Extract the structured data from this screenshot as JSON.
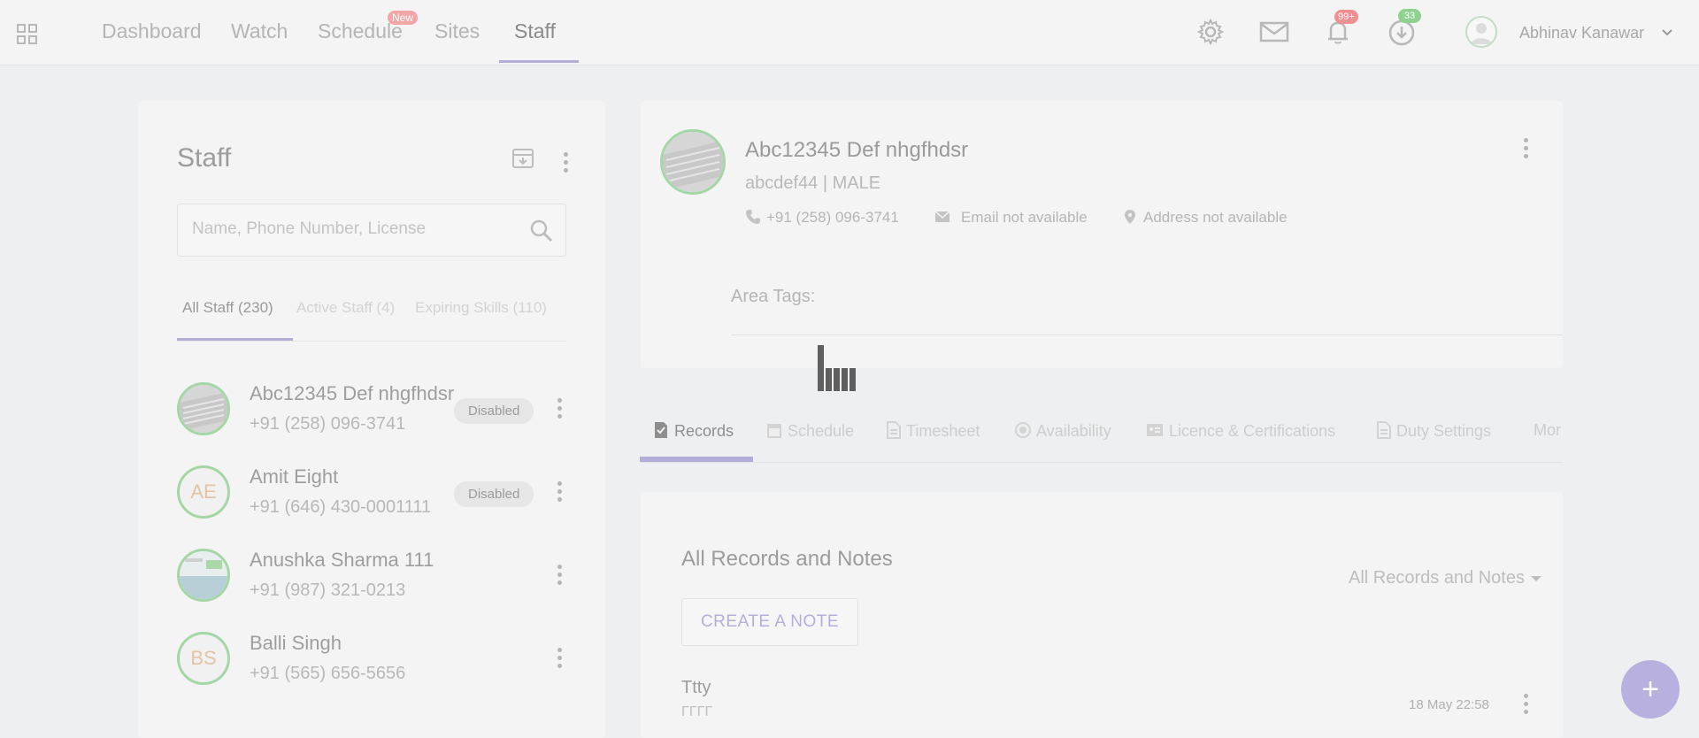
{
  "nav": {
    "items": [
      {
        "label": "Dashboard"
      },
      {
        "label": "Watch"
      },
      {
        "label": "Schedule",
        "badge": "New"
      },
      {
        "label": "Sites"
      },
      {
        "label": "Staff",
        "active": true
      }
    ],
    "notifications_count": "99+",
    "downloads_count": "33",
    "user_name": "Abhinav Kanawar",
    "icons": [
      "apps-grid-icon",
      "settings-gear-icon",
      "mail-icon",
      "bell-icon",
      "clock-download-icon",
      "chevron-down-icon"
    ]
  },
  "staff_panel": {
    "title": "Staff",
    "search_placeholder": "Name, Phone Number, License",
    "filters": [
      {
        "label": "All Staff (230)",
        "active": true
      },
      {
        "label": "Active Staff (4)"
      },
      {
        "label": "Expiring Skills (110)"
      }
    ],
    "staff": [
      {
        "name": "Abc12345 Def nhgfhdsr",
        "phone": "+91 (258) 096-3741",
        "status": "Disabled",
        "avatar": "photo"
      },
      {
        "name": "Amit Eight",
        "phone": "+91 (646) 430-0001111",
        "status": "Disabled",
        "initials": "AE"
      },
      {
        "name": "Anushka Sharma 111",
        "phone": "+91 (987) 321-0213",
        "status": "",
        "avatar": "photo"
      },
      {
        "name": "Balli Singh",
        "phone": "+91 (565) 656-5656",
        "status": "",
        "initials": "BS"
      }
    ]
  },
  "profile": {
    "name": "Abc12345 Def nhgfhdsr",
    "subtitle": "abcdef44 | MALE",
    "phone": "+91 (258) 096-3741",
    "email": "Email not available",
    "address": "Address not available",
    "area_tags_label": "Area Tags:"
  },
  "tabs": [
    {
      "label": "Records",
      "icon": "records-icon",
      "active": true
    },
    {
      "label": "Schedule",
      "icon": "calendar-icon"
    },
    {
      "label": "Timesheet",
      "icon": "document-icon"
    },
    {
      "label": "Availability",
      "icon": "availability-icon"
    },
    {
      "label": "Licence & Certifications",
      "icon": "id-card-icon"
    },
    {
      "label": "Duty Settings",
      "icon": "document-icon"
    },
    {
      "label": "Mor"
    }
  ],
  "records": {
    "title": "All Records and Notes",
    "filter_label": "All Records and Notes",
    "create_button": "CREATE A NOTE",
    "notes": [
      {
        "title": "Ttty",
        "body": "ΓΓΓΓ",
        "date": "18 May 22:58"
      }
    ]
  },
  "fab_label": "+",
  "colors": {
    "accent": "#b3acd6",
    "avatar_ring": "#a5d6a5",
    "notification_badge": "#f08f8f",
    "download_badge": "#8fd18f"
  }
}
